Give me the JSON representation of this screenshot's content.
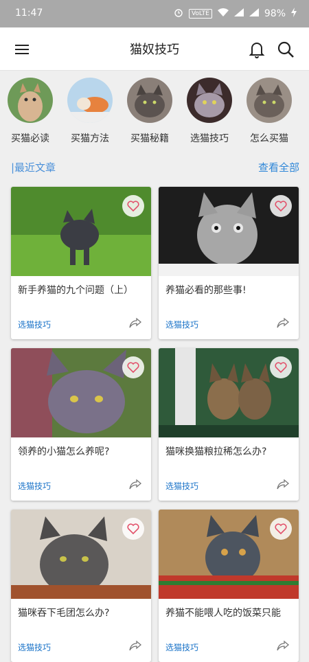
{
  "status": {
    "time": "11:47",
    "volte": "VoLTE",
    "battery": "98%"
  },
  "appbar": {
    "title": "猫奴技巧",
    "menu_icon": "menu-icon",
    "bell_icon": "bell-icon",
    "search_icon": "search-icon"
  },
  "categories": [
    {
      "label": "买猫必读"
    },
    {
      "label": "买猫方法"
    },
    {
      "label": "买猫秘籍"
    },
    {
      "label": "选猫技巧"
    },
    {
      "label": "怎么买猫"
    }
  ],
  "section": {
    "title": "|最近文章",
    "view_all": "查看全部"
  },
  "articles": [
    {
      "title": "新手养猫的九个问题（上）",
      "tag": "选猫技巧"
    },
    {
      "title": "养猫必看的那些事!",
      "tag": "选猫技巧"
    },
    {
      "title": "领养的小猫怎么养呢?",
      "tag": "选猫技巧"
    },
    {
      "title": "猫咪换猫粮拉稀怎么办?",
      "tag": "选猫技巧"
    },
    {
      "title": "猫咪吞下毛团怎么办?",
      "tag": "选猫技巧"
    },
    {
      "title": "养猫不能喂人吃的饭菜只能",
      "tag": "选猫技巧"
    }
  ],
  "colors": {
    "accent": "#2f87d8",
    "statusbar": "#a9a9a9",
    "tag": "#1a73c8"
  }
}
